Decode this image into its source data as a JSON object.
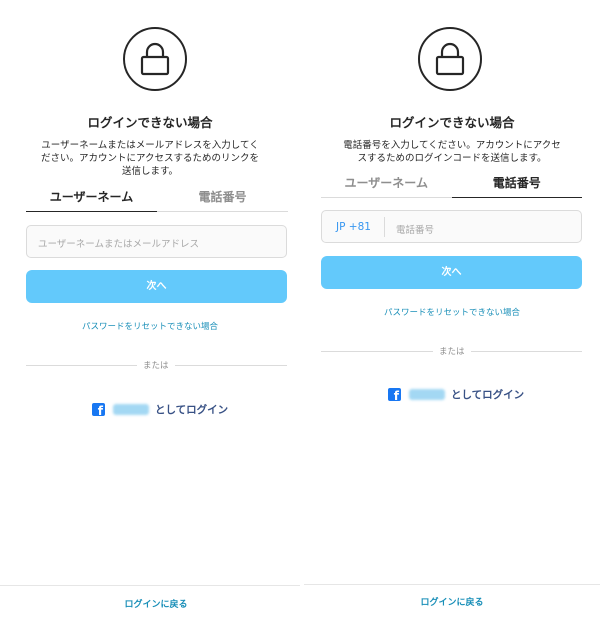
{
  "left": {
    "title": "ログインできない場合",
    "description_lines": [
      "ユーザーネームまたはメールアドレスを入力してく",
      "ださい。アカウントにアクセスするためのリンクを",
      "送信します。"
    ],
    "tabs": [
      {
        "label": "ユーザーネーム",
        "active": true
      },
      {
        "label": "電話番号",
        "active": false
      }
    ],
    "input_placeholder": "ユーザーネームまたはメールアドレス",
    "next_button": "次へ",
    "reset_link": "パスワードをリセットできない場合",
    "divider_text": "または",
    "facebook_login": "としてログイン",
    "back_to_login": "ログインに戻る"
  },
  "right": {
    "title": "ログインできない場合",
    "description_lines": [
      "電話番号を入力してください。アカウントにアクセ",
      "スするためのログインコードを送信します。"
    ],
    "tabs": [
      {
        "label": "ユーザーネーム",
        "active": false
      },
      {
        "label": "電話番号",
        "active": true
      }
    ],
    "country_code": "JP +81",
    "input_placeholder": "電話番号",
    "next_button": "次へ",
    "reset_link": "パスワードをリセットできない場合",
    "divider_text": "または",
    "facebook_login": "としてログイン",
    "back_to_login": "ログインに戻る"
  },
  "colors": {
    "accent_button": "#63c9fb",
    "link": "#1a8fb8",
    "facebook": "#1877f2"
  },
  "icons": [
    "lock-icon",
    "facebook-icon"
  ]
}
